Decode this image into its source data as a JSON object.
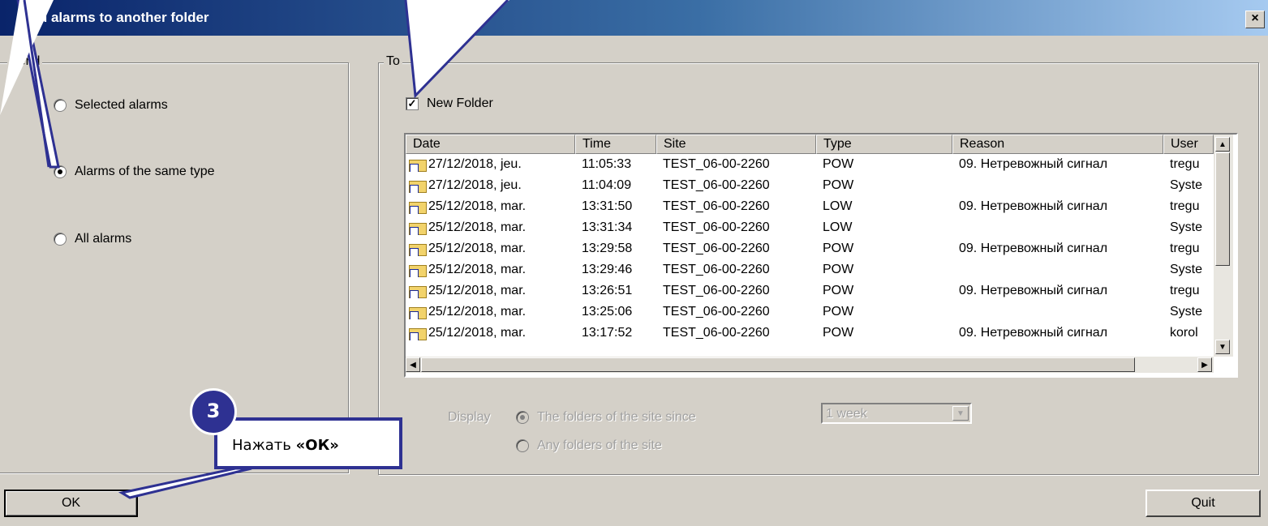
{
  "window": {
    "title": "end alarms to another folder",
    "close_glyph": "×"
  },
  "send_group": {
    "legend": "Send",
    "options": [
      {
        "label": "Selected alarms",
        "selected": false
      },
      {
        "label": "Alarms of the same type",
        "selected": true
      },
      {
        "label": "All alarms",
        "selected": false
      }
    ]
  },
  "to_group": {
    "legend": "To",
    "new_folder": {
      "label": "New Folder",
      "checked": true
    }
  },
  "alarm_list": {
    "columns": [
      "Date",
      "Time",
      "Site",
      "Type",
      "Reason",
      "User"
    ],
    "rows": [
      [
        "27/12/2018, jeu.",
        "11:05:33",
        "TEST_06-00-2260",
        "POW",
        "09. Нетревожный сигнал",
        "tregu"
      ],
      [
        "27/12/2018, jeu.",
        "11:04:09",
        "TEST_06-00-2260",
        "POW",
        "",
        "Syste"
      ],
      [
        "25/12/2018, mar.",
        "13:31:50",
        "TEST_06-00-2260",
        "LOW",
        "09. Нетревожный сигнал",
        "tregu"
      ],
      [
        "25/12/2018, mar.",
        "13:31:34",
        "TEST_06-00-2260",
        "LOW",
        "",
        "Syste"
      ],
      [
        "25/12/2018, mar.",
        "13:29:58",
        "TEST_06-00-2260",
        "POW",
        "09. Нетревожный сигнал",
        "tregu"
      ],
      [
        "25/12/2018, mar.",
        "13:29:46",
        "TEST_06-00-2260",
        "POW",
        "",
        "Syste"
      ],
      [
        "25/12/2018, mar.",
        "13:26:51",
        "TEST_06-00-2260",
        "POW",
        "09. Нетревожный сигнал",
        "tregu"
      ],
      [
        "25/12/2018, mar.",
        "13:25:06",
        "TEST_06-00-2260",
        "POW",
        "",
        "Syste"
      ],
      [
        "25/12/2018, mar.",
        "13:17:52",
        "TEST_06-00-2260",
        "POW",
        "09. Нетревожный сигнал",
        "korol"
      ]
    ],
    "row_icon": "folder-alarm-icon"
  },
  "display": {
    "label": "Display",
    "options": [
      {
        "label": "The folders of the site since",
        "selected": true
      },
      {
        "label": "Any folders of the site",
        "selected": false
      }
    ],
    "period_value": "1 week"
  },
  "buttons": {
    "ok": "OK",
    "quit": "Quit"
  },
  "annotation": {
    "step_number": "3",
    "text_prefix": "Нажать ",
    "text_bold": "«ОК»",
    "color": "#2e3192"
  },
  "colors": {
    "dialog_bg": "#d4d0c8",
    "title_gradient_start": "#0a246a",
    "title_gradient_end": "#a6caf0",
    "callout": "#2e3192"
  }
}
